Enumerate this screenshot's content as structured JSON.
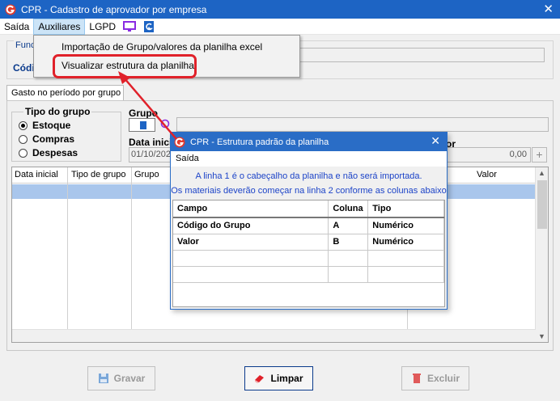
{
  "window": {
    "title": "CPR - Cadastro de aprovador por empresa",
    "close": "✕"
  },
  "menu": {
    "saida": "Saída",
    "auxiliares": "Auxiliares",
    "lgpd": "LGPD",
    "icons": [
      "monitor-icon",
      "app-g-icon"
    ]
  },
  "dropdown": {
    "items": [
      "Importação de Grupo/valores da planilha excel",
      "Visualizar estrutura da planilha"
    ]
  },
  "form": {
    "func_legend": "Func",
    "cod_label": "Códi",
    "tab_label": "Gasto no período por grupo",
    "tipo_grupo": {
      "legend": "Tipo do grupo",
      "options": [
        "Estoque",
        "Compras",
        "Despesas"
      ],
      "selected": "Estoque"
    },
    "grupo_label": "Grupo",
    "data_inicial_label": "Data inici",
    "data_inicial_value": "01/10/202",
    "valor_label": "or",
    "valor_value": "0,00",
    "plus": "+"
  },
  "grid": {
    "columns": [
      "Data inicial",
      "Tipo de grupo",
      "Grupo",
      "Valor"
    ]
  },
  "buttons": {
    "gravar": "Gravar",
    "limpar": "Limpar",
    "excluir": "Excluir"
  },
  "dialog": {
    "title": "CPR - Estrutura padrão da planilha",
    "close": "✕",
    "menu": "Saída",
    "msg1": "A linha 1 é o cabeçalho da planilha e não será importada.",
    "msg2": "Os materiais deverão começar na linha 2 conforme as colunas abaixo",
    "headers": [
      "Campo",
      "Coluna",
      "Tipo"
    ],
    "rows": [
      [
        "Código do Grupo",
        "A",
        "Numérico"
      ],
      [
        "Valor",
        "B",
        "Numérico"
      ]
    ]
  },
  "colors": {
    "titlebar": "#1d64c4",
    "highlight": "#e0212a",
    "message": "#1d44c8",
    "selected_row": "#a9c6ec"
  }
}
